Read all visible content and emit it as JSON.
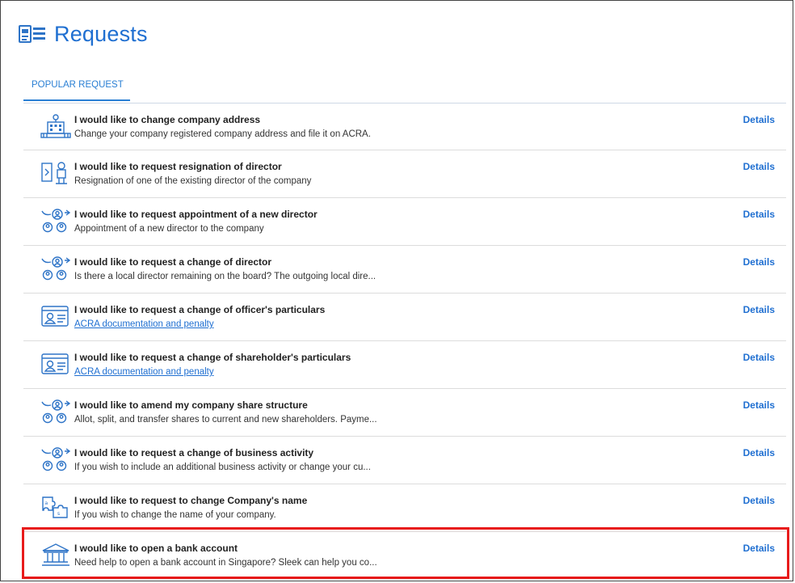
{
  "header": {
    "title": "Requests",
    "icon": "requests-icon"
  },
  "tabs": [
    {
      "label": "POPULAR REQUEST",
      "active": true
    }
  ],
  "requests": [
    {
      "icon": "building-address-icon",
      "title": "I would like to change company address",
      "desc": "Change your company registered company address and file it on ACRA.",
      "desc_link": false,
      "action": "Details"
    },
    {
      "icon": "director-resign-icon",
      "title": "I would like to request resignation of director",
      "desc": "Resignation of one of the existing director of the company",
      "desc_link": false,
      "action": "Details"
    },
    {
      "icon": "people-network-icon",
      "title": "I would like to request appointment of a new director",
      "desc": "Appointment of a new director to the company",
      "desc_link": false,
      "action": "Details"
    },
    {
      "icon": "people-network-icon",
      "title": "I would like to request a change of director",
      "desc": "Is there a local director remaining on the board? The outgoing local dire...",
      "desc_link": false,
      "action": "Details"
    },
    {
      "icon": "id-card-icon",
      "title": "I would like to request a change of officer's particulars",
      "desc": "ACRA documentation and penalty",
      "desc_link": true,
      "action": "Details"
    },
    {
      "icon": "id-card-icon",
      "title": "I would like to request a change of shareholder's particulars",
      "desc": "ACRA documentation and penalty",
      "desc_link": true,
      "action": "Details"
    },
    {
      "icon": "people-network-icon",
      "title": "I would like to amend my company share structure",
      "desc": "Allot, split, and transfer shares to current and new shareholders. Payme...",
      "desc_link": false,
      "action": "Details"
    },
    {
      "icon": "people-network-icon",
      "title": "I would like to request a change of business activity",
      "desc": "If you wish to include an additional business activity or change your cu...",
      "desc_link": false,
      "action": "Details"
    },
    {
      "icon": "puzzle-rename-icon",
      "title": "I would like to request to change Company's name",
      "desc": "If you wish to change the name of your company.",
      "desc_link": false,
      "action": "Details"
    },
    {
      "icon": "bank-icon",
      "title": "I would like to open a bank account",
      "desc": "Need help to open a bank account in Singapore? Sleek can help you co...",
      "desc_link": false,
      "action": "Details"
    }
  ],
  "colors": {
    "accent": "#1f6fd1",
    "highlight": "#e81b1b",
    "divider": "#dcdcdc"
  }
}
